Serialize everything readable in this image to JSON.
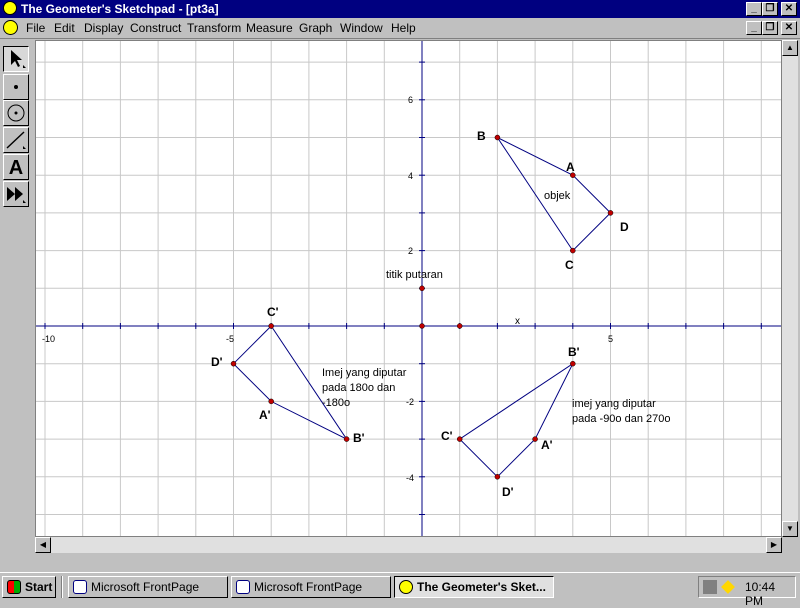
{
  "window": {
    "title": "The Geometer's Sketchpad - [pt3a]",
    "controls": [
      "_",
      "❐",
      "✕"
    ]
  },
  "menu": [
    "File",
    "Edit",
    "Display",
    "Construct",
    "Transform",
    "Measure",
    "Graph",
    "Window",
    "Help"
  ],
  "toolbox": [
    "arrow-select",
    "point",
    "compass",
    "straightedge",
    "text",
    "script"
  ],
  "tool_text_label": "A",
  "graph": {
    "x_tick_labels": {
      "x_minus_10": "-10",
      "x_minus_5": "-5",
      "x_5": "5"
    },
    "y_tick_labels": {
      "y_6": "6",
      "y_4": "4",
      "y_2": "2",
      "y_minus_2": "-2",
      "y_minus_4": "-4"
    },
    "axis_x_label": "x",
    "origin_marker_point": [
      1,
      0
    ],
    "rotation_center": {
      "label": "titik putaran",
      "x": 0,
      "y": 1
    },
    "object": {
      "label": "objek",
      "points": [
        {
          "name": "A",
          "x": 4,
          "y": 4
        },
        {
          "name": "B",
          "x": 2,
          "y": 5
        },
        {
          "name": "C",
          "x": 4,
          "y": 2
        },
        {
          "name": "D",
          "x": 5,
          "y": 3
        }
      ]
    },
    "image_180": {
      "label_lines": [
        "Imej yang diputar",
        "pada 180o dan",
        "-180o"
      ],
      "points": [
        {
          "name": "A'",
          "x": -4,
          "y": -2
        },
        {
          "name": "B'",
          "x": -2,
          "y": -3
        },
        {
          "name": "C'",
          "x": -4,
          "y": 0
        },
        {
          "name": "D'",
          "x": -5,
          "y": -1
        }
      ]
    },
    "image_270": {
      "label_lines": [
        "imej yang diputar",
        "pada -90o dan 270o"
      ],
      "points": [
        {
          "name": "A'",
          "x": 3,
          "y": -3
        },
        {
          "name": "B'",
          "x": 4,
          "y": -1
        },
        {
          "name": "C'",
          "x": 1,
          "y": -3
        },
        {
          "name": "D'",
          "x": 2,
          "y": -4
        }
      ]
    }
  },
  "taskbar": {
    "start": "Start",
    "buttons": [
      "Microsoft FrontPage",
      "Microsoft FrontPage",
      "The Geometer's Sket..."
    ],
    "clock": "10:44 PM"
  },
  "colors": {
    "titlebar": "#000080",
    "line": "#000080",
    "point": "#c00000",
    "grid": "#c8c8c8"
  }
}
